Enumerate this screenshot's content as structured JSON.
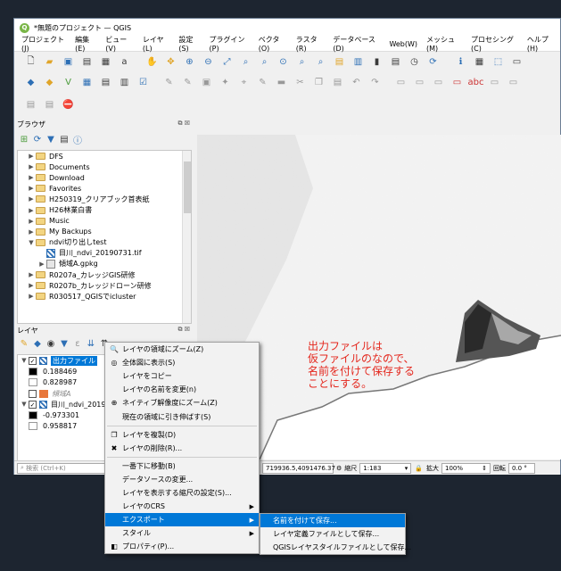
{
  "window": {
    "title": "*無題のプロジェクト — QGIS"
  },
  "menu": [
    "プロジェクト(J)",
    "編集(E)",
    "ビュー(V)",
    "レイヤ(L)",
    "設定(S)",
    "プラグイン(P)",
    "ベクタ(O)",
    "ラスタ(R)",
    "データベース(D)",
    "Web(W)",
    "メッシュ(M)",
    "プロセシング(C)",
    "ヘルプ(H)"
  ],
  "browser": {
    "title": "ブラウザ",
    "items": [
      {
        "label": "DFS",
        "indent": 0,
        "arrow": "▶",
        "icon": "folder"
      },
      {
        "label": "Documents",
        "indent": 0,
        "arrow": "▶",
        "icon": "folder"
      },
      {
        "label": "Download",
        "indent": 0,
        "arrow": "▶",
        "icon": "folder"
      },
      {
        "label": "Favorites",
        "indent": 0,
        "arrow": "▶",
        "icon": "folder"
      },
      {
        "label": "H250319_クリアブック首表紙",
        "indent": 0,
        "arrow": "▶",
        "icon": "folder"
      },
      {
        "label": "H26林業白書",
        "indent": 0,
        "arrow": "▶",
        "icon": "folder"
      },
      {
        "label": "Music",
        "indent": 0,
        "arrow": "▶",
        "icon": "folder"
      },
      {
        "label": "My Backups",
        "indent": 0,
        "arrow": "▶",
        "icon": "folder"
      },
      {
        "label": "ndvi切り出しtest",
        "indent": 0,
        "arrow": "▼",
        "icon": "folder"
      },
      {
        "label": "目川_ndvi_20190731.tif",
        "indent": 1,
        "arrow": "",
        "icon": "raster"
      },
      {
        "label": "傾域A.gpkg",
        "indent": 1,
        "arrow": "▶",
        "icon": "db"
      },
      {
        "label": "R0207a_カレッジGIS研修",
        "indent": 0,
        "arrow": "▶",
        "icon": "folder"
      },
      {
        "label": "R0207b_カレッジドローン研修",
        "indent": 0,
        "arrow": "▶",
        "icon": "folder"
      },
      {
        "label": "R030517_QGISでicluster",
        "indent": 0,
        "arrow": "▶",
        "icon": "folder"
      }
    ]
  },
  "layers": {
    "title": "レイヤ",
    "items": [
      {
        "label": "出力ファイル",
        "type": "layer",
        "selected": true,
        "checked": true
      },
      {
        "label": "0.188469",
        "type": "legend",
        "color": "#000000"
      },
      {
        "label": "0.828987",
        "type": "legend",
        "color": "#ffffff"
      },
      {
        "label": "傾域A",
        "type": "layer",
        "checked": false,
        "italic": true,
        "swatch": "#e8773a"
      },
      {
        "label": "目川_ndvi_2019",
        "type": "layer",
        "checked": true
      },
      {
        "label": "-0.973301",
        "type": "legend",
        "color": "#000000"
      },
      {
        "label": "0.958817",
        "type": "legend",
        "color": "#ffffff"
      }
    ]
  },
  "map_note": [
    "出力ファイルは",
    "仮ファイルのなので、",
    "名前を付けて保存する",
    "ことにする。"
  ],
  "context_menu": {
    "items": [
      {
        "label": "レイヤの領域にズーム(Z)",
        "icon": "🔍"
      },
      {
        "label": "全体図に表示(S)",
        "icon": "◎"
      },
      {
        "label": "レイヤをコピー",
        "icon": ""
      },
      {
        "label": "レイヤの名前を変更(n)",
        "icon": ""
      },
      {
        "label": "ネイティブ解像度にズーム(Z)",
        "icon": "⊕"
      },
      {
        "label": "現在の領域に引き伸ばす(S)",
        "icon": ""
      },
      {
        "sep": true
      },
      {
        "label": "レイヤを複製(D)",
        "icon": "❐"
      },
      {
        "label": "レイヤの削除(R)...",
        "icon": "✖"
      },
      {
        "sep": true
      },
      {
        "label": "一番下に移動(B)",
        "icon": ""
      },
      {
        "label": "データソースの変更...",
        "icon": ""
      },
      {
        "label": "レイヤを表示する縮尺の設定(S)...",
        "icon": ""
      },
      {
        "label": "レイヤのCRS",
        "icon": "",
        "sub": true
      },
      {
        "label": "エクスポート",
        "icon": "",
        "sub": true,
        "highlight": true
      },
      {
        "label": "スタイル",
        "icon": "",
        "sub": true
      },
      {
        "label": "プロパティ(P)...",
        "icon": "◧"
      }
    ]
  },
  "submenu": {
    "items": [
      {
        "label": "名前を付けて保存...",
        "highlight": true
      },
      {
        "label": "レイヤ定義ファイルとして保存..."
      },
      {
        "label": "QGISレイヤスタイルファイルとして保存..."
      }
    ]
  },
  "status": {
    "search_placeholder": "検索 (Ctrl+K)",
    "coordinate": "719936.5,4091476.37",
    "scale_label": "縮尺",
    "scale_value": "1:183",
    "magnifier_label": "拡大",
    "magnifier_value": "100%",
    "rotation_label": "回転",
    "rotation_value": "0.0 °"
  }
}
